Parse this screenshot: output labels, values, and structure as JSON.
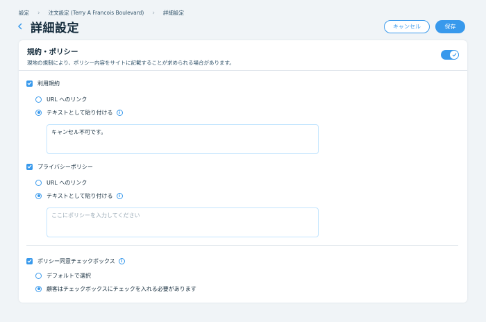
{
  "breadcrumb": {
    "items": [
      "設定",
      "注文設定 (Terry A Francois Boulevard)",
      "詳細設定"
    ]
  },
  "header": {
    "title": "詳細設定",
    "cancel_label": "キャンセル",
    "save_label": "保存"
  },
  "policies": {
    "title": "規約・ポリシー",
    "subtitle": "現地の規制により、ポリシー内容をサイトに記載することが求められる場合があります。",
    "enabled": true
  },
  "terms": {
    "label": "利用規約",
    "checked": true,
    "option_url": "URL へのリンク",
    "option_text": "テキストとして貼り付ける",
    "value": "キャンセル不可です。"
  },
  "privacy": {
    "label": "プライバシーポリシー",
    "checked": true,
    "option_url": "URL へのリンク",
    "option_text": "テキストとして貼り付ける",
    "placeholder": "ここにポリシーを入力してください"
  },
  "agreement": {
    "label": "ポリシー同意チェックボックス",
    "checked": true,
    "option_default": "デフォルトで選択",
    "option_required": "顧客はチェックボックスにチェックを入れる必要があります"
  },
  "colors": {
    "accent": "#3899ec",
    "background": "#f0f4f7",
    "text": "#162d3d"
  },
  "icons": [
    "back-icon",
    "chevron-right-icon",
    "check-icon",
    "info-icon"
  ]
}
